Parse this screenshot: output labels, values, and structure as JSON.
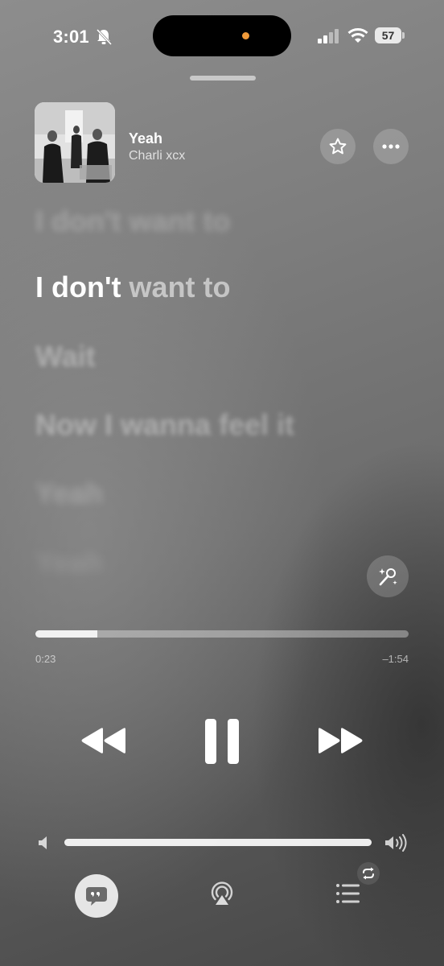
{
  "status_bar": {
    "time": "3:01",
    "battery": "57",
    "icons": [
      "bell-slash-icon",
      "cellular-signal-icon",
      "wifi-icon",
      "battery-icon"
    ]
  },
  "now_playing": {
    "title": "Yeah",
    "artist": "Charli xcx"
  },
  "lyrics": {
    "prev_line": "I don't want to",
    "current_sung": "I don't",
    "current_unsung": "want to",
    "upcoming": [
      "Wait",
      "Now I wanna feel it",
      "Yeah",
      "Yeah"
    ]
  },
  "playback": {
    "elapsed": "0:23",
    "remaining": "–1:54",
    "progress_fraction": 0.166,
    "volume_fraction": 1.0
  },
  "colors": {
    "accent": "#ffffff",
    "camera_dot": "#f09a3a"
  }
}
